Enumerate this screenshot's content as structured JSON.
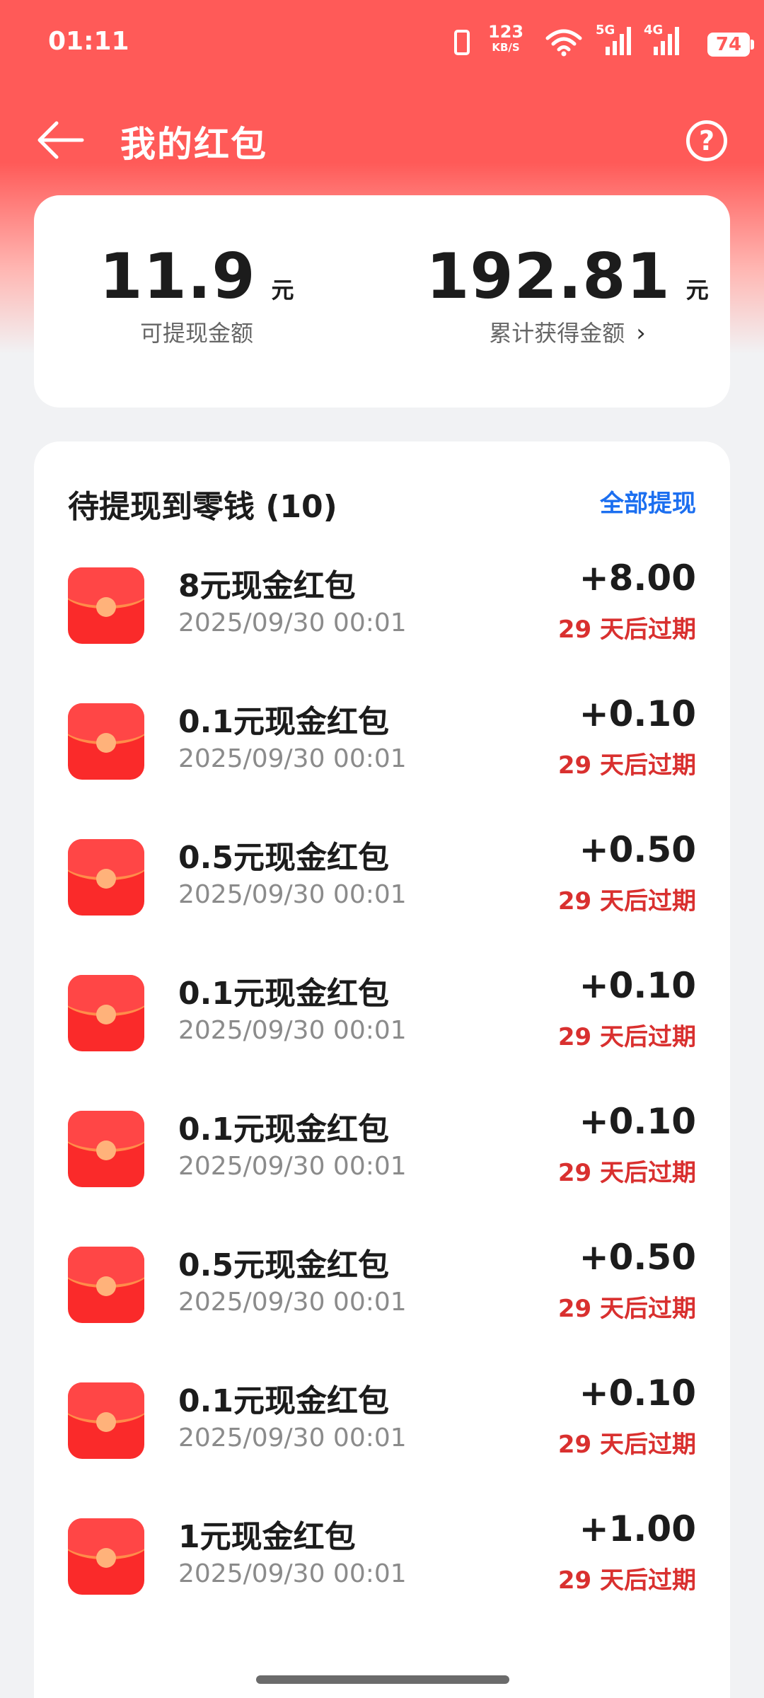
{
  "status_bar": {
    "time": "01:11",
    "net_speed_value": "123",
    "net_speed_unit": "KB/S",
    "sig1_label": "5G",
    "sig2_label": "4G",
    "battery": "74"
  },
  "header": {
    "title": "我的红包",
    "help": "?"
  },
  "summary": {
    "withdrawable_amount": "11.9",
    "withdrawable_unit": "元",
    "withdrawable_label": "可提现金额",
    "total_amount": "192.81",
    "total_unit": "元",
    "total_label": "累计获得金额"
  },
  "list": {
    "heading": "待提现到零钱 (10)",
    "withdraw_all": "全部提现",
    "items": [
      {
        "name": "8元现金红包",
        "date": "2025/09/30 00:01",
        "amount": "+8.00",
        "expiry": "29 天后过期"
      },
      {
        "name": "0.1元现金红包",
        "date": "2025/09/30 00:01",
        "amount": "+0.10",
        "expiry": "29 天后过期"
      },
      {
        "name": "0.5元现金红包",
        "date": "2025/09/30 00:01",
        "amount": "+0.50",
        "expiry": "29 天后过期"
      },
      {
        "name": "0.1元现金红包",
        "date": "2025/09/30 00:01",
        "amount": "+0.10",
        "expiry": "29 天后过期"
      },
      {
        "name": "0.1元现金红包",
        "date": "2025/09/30 00:01",
        "amount": "+0.10",
        "expiry": "29 天后过期"
      },
      {
        "name": "0.5元现金红包",
        "date": "2025/09/30 00:01",
        "amount": "+0.50",
        "expiry": "29 天后过期"
      },
      {
        "name": "0.1元现金红包",
        "date": "2025/09/30 00:01",
        "amount": "+0.10",
        "expiry": "29 天后过期"
      },
      {
        "name": "1元现金红包",
        "date": "2025/09/30 00:01",
        "amount": "+1.00",
        "expiry": "29 天后过期"
      }
    ]
  },
  "colors": {
    "header_red": "#ff5a58",
    "link_blue": "#1c6ff0",
    "expiry_red": "#d9302f",
    "packet_red": "#fa2a2a"
  },
  "icons": [
    "back-arrow-icon",
    "help-circle-icon",
    "chevron-right-icon",
    "red-packet-icon"
  ]
}
